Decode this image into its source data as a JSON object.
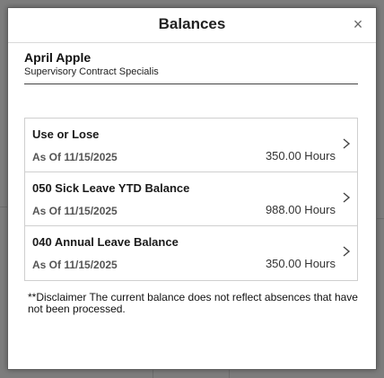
{
  "modal": {
    "title": "Balances",
    "close_glyph": "×"
  },
  "person": {
    "name": "April Apple",
    "job_title": "Supervisory Contract Specialis"
  },
  "balances": [
    {
      "label": "Use or Lose",
      "as_of": "As Of 11/15/2025",
      "value": "350.00 Hours"
    },
    {
      "label": "050 Sick Leave YTD Balance",
      "as_of": "As Of 11/15/2025",
      "value": "988.00 Hours"
    },
    {
      "label": "040 Annual Leave Balance",
      "as_of": "As Of 11/15/2025",
      "value": "350.00 Hours"
    }
  ],
  "disclaimer": "**Disclaimer  The current balance does not reflect absences that have not been processed.",
  "icons": {
    "close": "close-icon",
    "chevron": "chevron-right-icon"
  }
}
